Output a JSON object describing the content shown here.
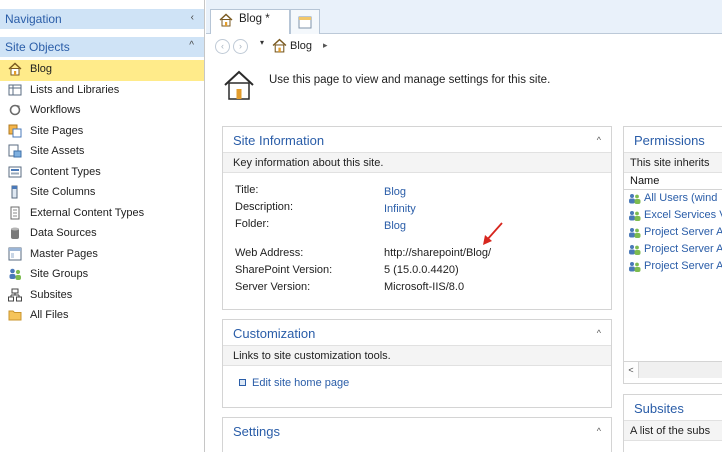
{
  "nav": {
    "title": "Navigation",
    "collapse_glyph": "‹",
    "section": "Site Objects",
    "section_toggle_glyph": "^",
    "items": [
      {
        "label": "Blog",
        "icon": "home-icon",
        "selected": true
      },
      {
        "label": "Lists and Libraries",
        "icon": "list-icon"
      },
      {
        "label": "Workflows",
        "icon": "workflow-icon"
      },
      {
        "label": "Site Pages",
        "icon": "site-pages-icon"
      },
      {
        "label": "Site Assets",
        "icon": "site-assets-icon"
      },
      {
        "label": "Content Types",
        "icon": "content-types-icon"
      },
      {
        "label": "Site Columns",
        "icon": "site-columns-icon"
      },
      {
        "label": "External Content Types",
        "icon": "external-content-icon"
      },
      {
        "label": "Data Sources",
        "icon": "database-icon"
      },
      {
        "label": "Master Pages",
        "icon": "master-pages-icon"
      },
      {
        "label": "Site Groups",
        "icon": "groups-icon"
      },
      {
        "label": "Subsites",
        "icon": "subsites-icon"
      },
      {
        "label": "All Files",
        "icon": "folder-icon"
      }
    ]
  },
  "tabs": {
    "active_label": "Blog *"
  },
  "breadcrumb": {
    "back_glyph": "‹",
    "forward_glyph": "›",
    "dropdown_glyph": "▾",
    "label": "Blog",
    "arrow_glyph": "▸"
  },
  "page": {
    "description": "Use this page to view and manage settings for this site."
  },
  "site_info": {
    "title": "Site Information",
    "toggle_glyph": "^",
    "subtitle": "Key information about this site.",
    "rows": [
      {
        "key": "Title:",
        "value": "Blog",
        "is_link": true
      },
      {
        "key": "Description:",
        "value": "Infinity",
        "is_link": true
      },
      {
        "key": "Folder:",
        "value": "Blog",
        "is_link": true
      },
      {
        "key": "Web Address:",
        "value": "http://sharepoint/Blog/",
        "is_link": false
      },
      {
        "key": "SharePoint Version:",
        "value": "5 (15.0.0.4420)",
        "is_link": false
      },
      {
        "key": "Server Version:",
        "value": "Microsoft-IIS/8.0",
        "is_link": false
      }
    ]
  },
  "customization": {
    "title": "Customization",
    "toggle_glyph": "^",
    "subtitle": "Links to site customization tools.",
    "links": [
      "Edit site home page"
    ]
  },
  "settings": {
    "title": "Settings",
    "toggle_glyph": "^"
  },
  "permissions": {
    "title": "Permissions",
    "subtitle": "This site inherits",
    "column": "Name",
    "rows": [
      "All Users (wind",
      "Excel Services V",
      "Project Server A",
      "Project Server A",
      "Project Server A"
    ],
    "scroll_left_glyph": "<"
  },
  "subsites": {
    "title": "Subsites",
    "subtitle": "A list of the subs"
  },
  "colors": {
    "nav_header_bg": "#cfe3f6",
    "selected_bg": "#ffeb8a",
    "link": "#2a5da8",
    "annotation_arrow": "#d7261e"
  }
}
